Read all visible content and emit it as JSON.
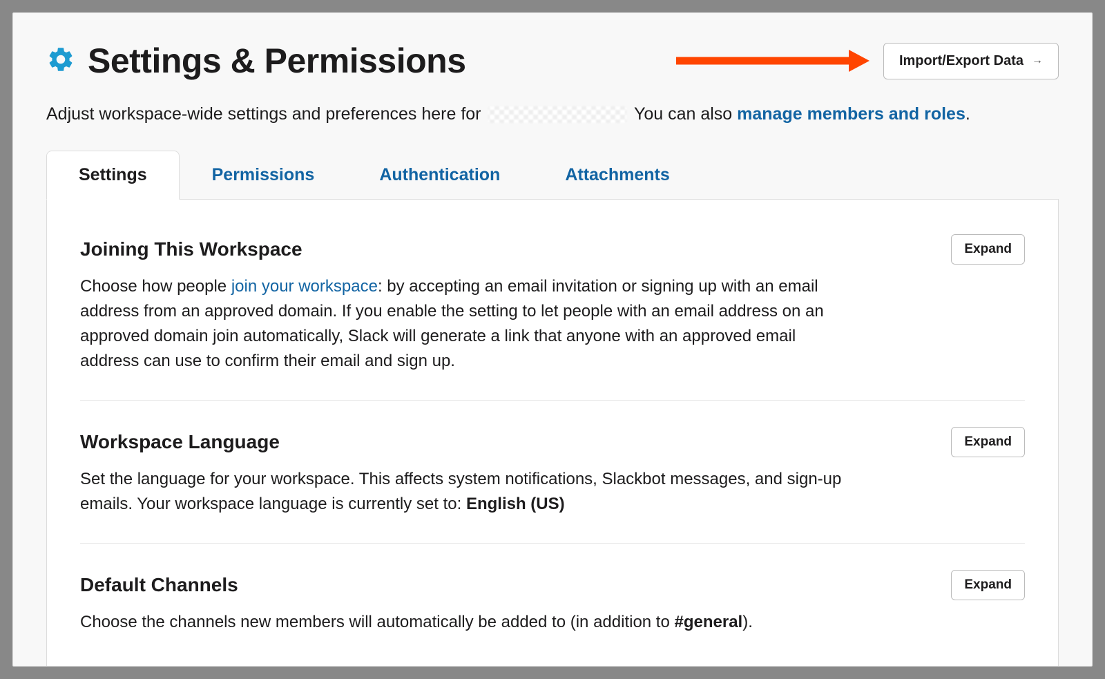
{
  "header": {
    "title": "Settings & Permissions",
    "import_button": "Import/Export Data"
  },
  "subtitle": {
    "prefix": "Adjust workspace-wide settings and preferences here for",
    "suffix": "You can also ",
    "link": "manage members and roles",
    "period": "."
  },
  "tabs": [
    {
      "label": "Settings",
      "active": true
    },
    {
      "label": "Permissions",
      "active": false
    },
    {
      "label": "Authentication",
      "active": false
    },
    {
      "label": "Attachments",
      "active": false
    }
  ],
  "sections": {
    "joining": {
      "title": "Joining This Workspace",
      "expand": "Expand",
      "desc_prefix": "Choose how people ",
      "desc_link": "join your workspace",
      "desc_suffix": ": by accepting an email invitation or signing up with an email address from an approved domain. If you enable the setting to let people with an email address on an approved domain join automatically, Slack will generate a link that anyone with an approved email address can use to confirm their email and sign up."
    },
    "language": {
      "title": "Workspace Language",
      "expand": "Expand",
      "desc_prefix": "Set the language for your workspace. This affects system notifications, Slackbot messages, and sign-up emails. Your workspace language is currently set to: ",
      "desc_bold": "English (US)"
    },
    "channels": {
      "title": "Default Channels",
      "expand": "Expand",
      "desc_prefix": "Choose the channels new members will automatically be added to (in addition to ",
      "desc_bold": "#general",
      "desc_suffix": ")."
    }
  }
}
